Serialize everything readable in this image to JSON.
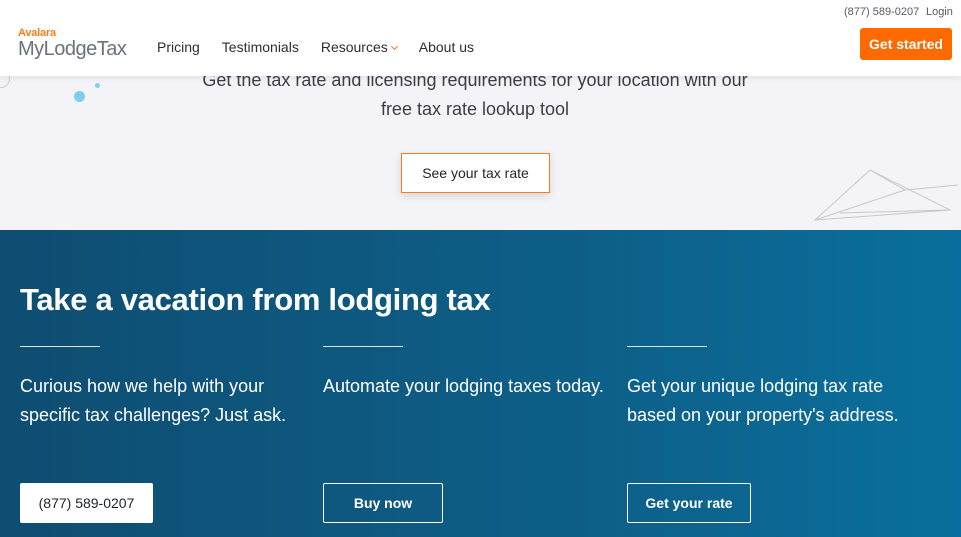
{
  "header": {
    "phone": "(877) 589-0207",
    "login": "Login",
    "logo_brand": "Avalara",
    "logo_product": "MyLodgeTax",
    "nav": [
      "Pricing",
      "Testimonials",
      "Resources",
      "About us"
    ],
    "cta": "Get started"
  },
  "hero": {
    "text_line1": "Get the tax rate and licensing requirements for your location with our",
    "text_line2": "free tax rate lookup tool",
    "button": "See your tax rate"
  },
  "blue": {
    "title": "Take a vacation from lodging tax",
    "columns": [
      {
        "text": "Curious how we help with your specific tax challenges? Just ask.",
        "button": "(877) 589-0207"
      },
      {
        "text": "Automate your lodging taxes today.",
        "button": "Buy now"
      },
      {
        "text": "Get your unique lodging tax rate based on your property's address.",
        "button": "Get your rate"
      }
    ]
  },
  "colors": {
    "accent": "#ff6a00",
    "blue_dark": "#0f4d72",
    "blue_light": "#0a6f9c"
  }
}
